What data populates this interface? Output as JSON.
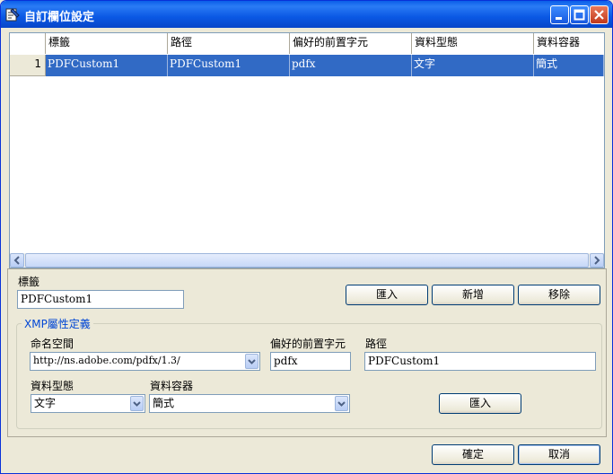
{
  "window": {
    "title": "自訂欄位設定"
  },
  "grid": {
    "columns": [
      "標籤",
      "路徑",
      "偏好的前置字元",
      "資料型態",
      "資料容器"
    ],
    "rows": [
      {
        "num": "1",
        "cells": [
          "PDFCustom1",
          "PDFCustom1",
          "pdfx",
          "文字",
          "簡式"
        ]
      }
    ]
  },
  "tag_section": {
    "label": "標籤",
    "value": "PDFCustom1",
    "import_label": "匯入",
    "add_label": "新增",
    "remove_label": "移除"
  },
  "xmp": {
    "group_title": "XMP屬性定義",
    "namespace_label": "命名空間",
    "namespace_value": "http://ns.adobe.com/pdfx/1.3/",
    "prefix_label": "偏好的前置字元",
    "prefix_value": "pdfx",
    "path_label": "路徑",
    "path_value": "PDFCustom1",
    "datatype_label": "資料型態",
    "datatype_value": "文字",
    "container_label": "資料容器",
    "container_value": "簡式",
    "import_label": "匯入"
  },
  "footer": {
    "ok_label": "確定",
    "cancel_label": "取消"
  }
}
